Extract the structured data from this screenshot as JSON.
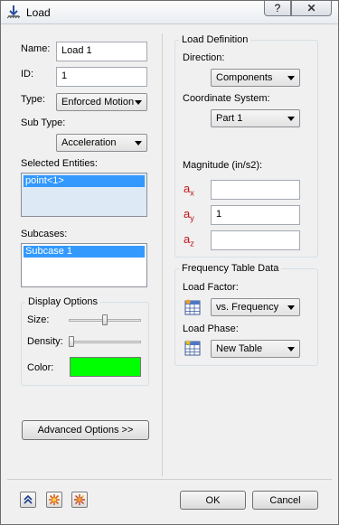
{
  "window": {
    "title": "Load",
    "help_glyph": "?",
    "close_glyph": "✕"
  },
  "left": {
    "name_label": "Name:",
    "name_value": "Load 1",
    "id_label": "ID:",
    "id_value": "1",
    "type_label": "Type:",
    "type_value": "Enforced Motion",
    "subtype_label": "Sub Type:",
    "subtype_value": "Acceleration",
    "selected_entities_label": "Selected Entities:",
    "selected_entities": [
      "point<1>"
    ],
    "subcases_label": "Subcases:",
    "subcases": [
      "Subcase 1"
    ],
    "display_options": {
      "title": "Display Options",
      "size_label": "Size:",
      "size_level": 0.5,
      "density_label": "Density:",
      "density_level": 0.0,
      "color_label": "Color:",
      "color_value": "#00ff00"
    },
    "advanced_button": "Advanced Options >>"
  },
  "right": {
    "load_definition": {
      "title": "Load Definition",
      "direction_label": "Direction:",
      "direction_value": "Components",
      "coord_label": "Coordinate System:",
      "coord_value": "Part 1",
      "magnitude_label": "Magnitude (in/s2):",
      "ax_label": "a",
      "ax_sub": "x",
      "ax_value": "",
      "ay_label": "a",
      "ay_sub": "y",
      "ay_value": "1",
      "az_label": "a",
      "az_sub": "z",
      "az_value": ""
    },
    "frequency_table": {
      "title": "Frequency Table Data",
      "load_factor_label": "Load Factor:",
      "load_factor_value": "vs. Frequency",
      "load_phase_label": "Load Phase:",
      "load_phase_value": "New Table"
    }
  },
  "footer": {
    "ok": "OK",
    "cancel": "Cancel"
  },
  "colors": {
    "selection": "#3399ff",
    "magnitude_label": "#c0131a",
    "swatch": "#00ff00"
  }
}
